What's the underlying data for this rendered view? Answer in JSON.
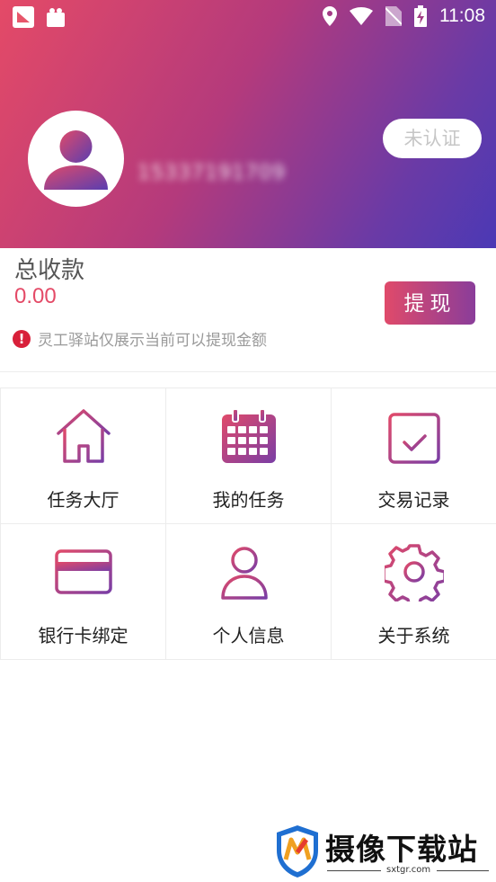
{
  "status_bar": {
    "time": "11:08"
  },
  "profile": {
    "phone": "15337191709",
    "verify_badge": "未认证"
  },
  "earnings": {
    "title": "总收款",
    "amount": "0.00",
    "withdraw_label": "提现",
    "notice": "灵工驿站仅展示当前可以提现金额"
  },
  "menu": [
    {
      "label": "任务大厅",
      "icon": "home-icon"
    },
    {
      "label": "我的任务",
      "icon": "calendar-grid-icon"
    },
    {
      "label": "交易记录",
      "icon": "calendar-check-icon"
    },
    {
      "label": "银行卡绑定",
      "icon": "bank-card-icon"
    },
    {
      "label": "个人信息",
      "icon": "user-info-icon"
    },
    {
      "label": "关于系统",
      "icon": "gear-icon"
    }
  ],
  "watermark": {
    "text": "摄像下载站",
    "url": "sxtgr.com"
  },
  "colors": {
    "accent_start": "#e44a67",
    "accent_end": "#4b39b5",
    "amount": "#e44a67",
    "notice_icon": "#d8203a"
  }
}
